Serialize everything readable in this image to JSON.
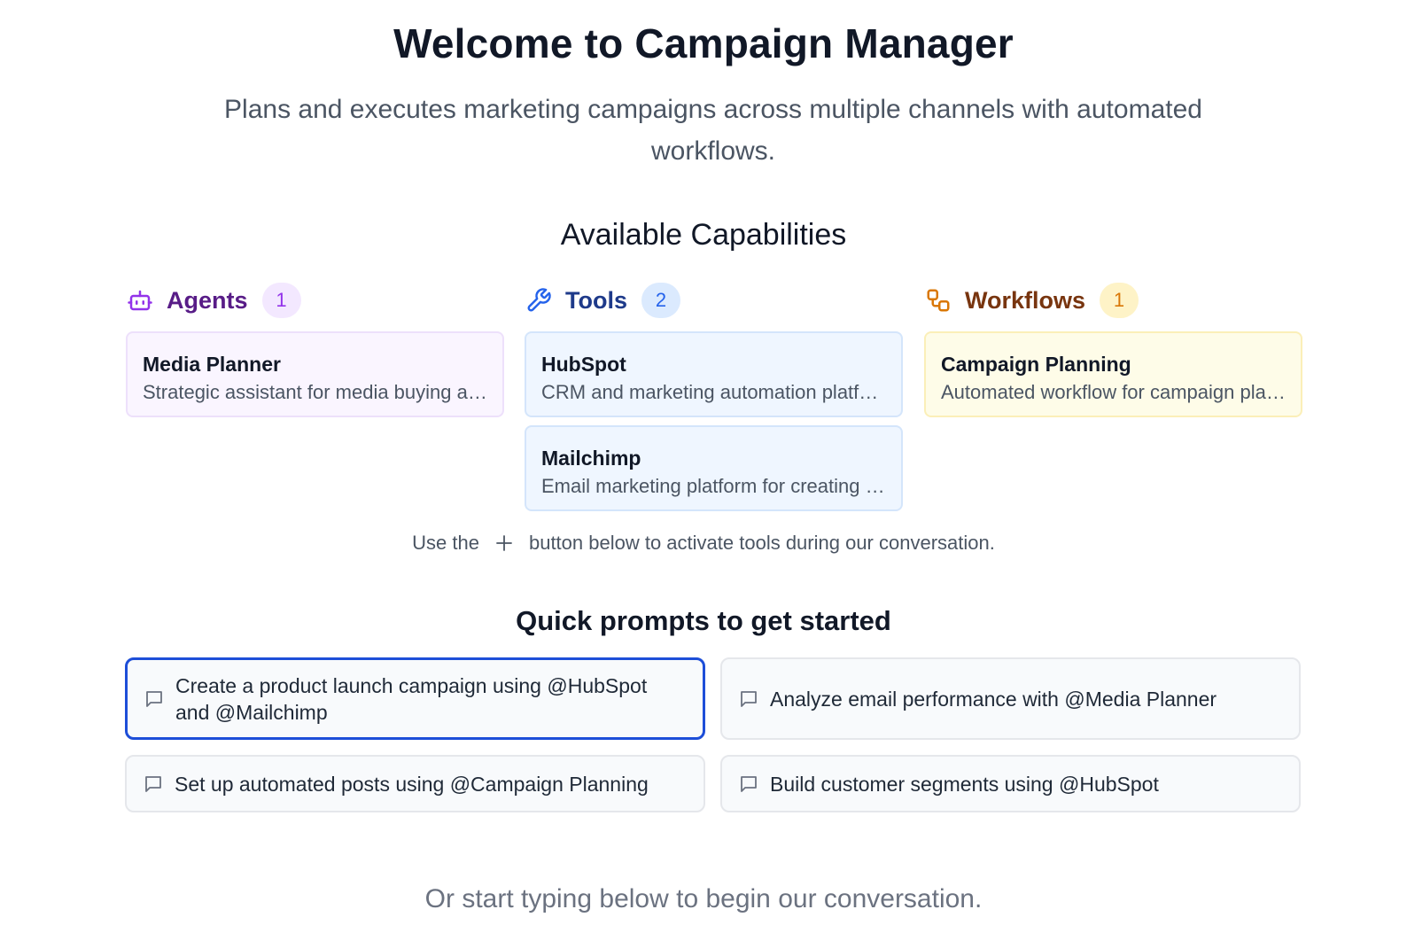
{
  "header": {
    "title": "Welcome to Campaign Manager",
    "subtitle": "Plans and executes marketing campaigns across multiple channels with automated workflows."
  },
  "capabilities": {
    "title": "Available Capabilities",
    "agents": {
      "label": "Agents",
      "count": "1",
      "icon": "robot-icon",
      "items": [
        {
          "name": "Media Planner",
          "description": "Strategic assistant for media buying and planning"
        }
      ]
    },
    "tools": {
      "label": "Tools",
      "count": "2",
      "icon": "wrench-icon",
      "items": [
        {
          "name": "HubSpot",
          "description": "CRM and marketing automation platform"
        },
        {
          "name": "Mailchimp",
          "description": "Email marketing platform for creating campaigns"
        }
      ]
    },
    "workflows": {
      "label": "Workflows",
      "count": "1",
      "icon": "workflow-icon",
      "items": [
        {
          "name": "Campaign Planning",
          "description": "Automated workflow for campaign planning"
        }
      ]
    },
    "hint_before": "Use the",
    "hint_after": "button below to activate tools during our conversation."
  },
  "quick_prompts": {
    "title": "Quick prompts to get started",
    "items": [
      {
        "text": "Create a product launch campaign using @HubSpot and @Mailchimp",
        "selected": true
      },
      {
        "text": "Analyze email performance with @Media Planner"
      },
      {
        "text": "Set up automated posts using @Campaign Planning"
      },
      {
        "text": "Build customer segments using @HubSpot"
      }
    ]
  },
  "footer": {
    "text": "Or start typing below to begin our conversation."
  },
  "colors": {
    "agents": "#9333ea",
    "tools": "#2563eb",
    "workflows": "#d97706",
    "selected_border": "#1d4ed8"
  }
}
